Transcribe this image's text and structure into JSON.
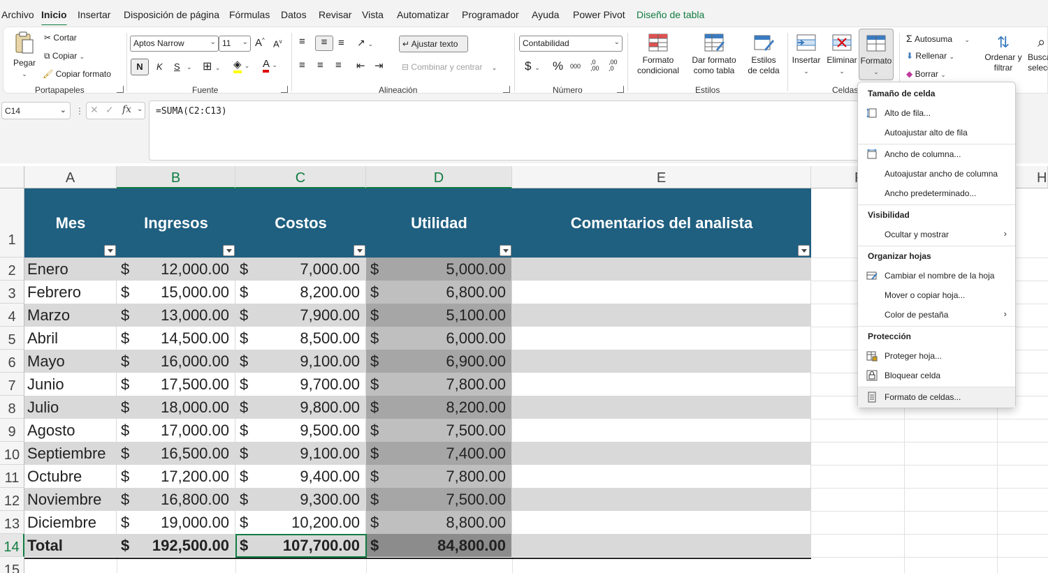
{
  "menu_tabs": [
    "Archivo",
    "Inicio",
    "Insertar",
    "Disposición de página",
    "Fórmulas",
    "Datos",
    "Revisar",
    "Vista",
    "Automatizar",
    "Programador",
    "Ayuda",
    "Power Pivot",
    "Diseño de tabla"
  ],
  "ribbon": {
    "clipboard": {
      "paste": "Pegar",
      "cut": "Cortar",
      "copy": "Copiar",
      "format_painter": "Copiar formato",
      "label": "Portapapeles"
    },
    "font": {
      "name": "Aptos Narrow",
      "size": "11",
      "bold": "N",
      "italic": "K",
      "underline": "S",
      "label": "Fuente"
    },
    "alignment": {
      "wrap": "Ajustar texto",
      "merge": "Combinar y centrar",
      "label": "Alineación"
    },
    "number": {
      "format": "Contabilidad",
      "currency": "$",
      "percent": "%",
      "thousands": "000",
      "inc_dec": ",0\n,00",
      "dec_dec": ",00\n,0",
      "label": "Número"
    },
    "styles": {
      "conditional": "Formato condicional",
      "as_table": "Dar formato como tabla",
      "cell_styles": "Estilos de celda",
      "label": "Estilos"
    },
    "cells": {
      "insert": "Insertar",
      "delete": "Eliminar",
      "format": "Formato",
      "label": "Celdas"
    },
    "editing": {
      "autosum": "Autosuma",
      "fill": "Rellenar",
      "clear": "Borrar",
      "sort": "Ordenar y filtrar",
      "find": "Buscar y seleccionar"
    }
  },
  "formula_bar": {
    "name_box": "C14",
    "formula": "=SUMA(C2:C13)",
    "fx": "fx"
  },
  "columns": [
    "A",
    "B",
    "C",
    "D",
    "E",
    "F",
    "H"
  ],
  "row_numbers": [
    "1",
    "2",
    "3",
    "4",
    "5",
    "6",
    "7",
    "8",
    "9",
    "10",
    "11",
    "12",
    "13",
    "14",
    "15"
  ],
  "table": {
    "headers": [
      "Mes",
      "Ingresos",
      "Costos",
      "Utilidad",
      "Comentarios del analista"
    ],
    "currency": "$",
    "rows": [
      [
        "Enero",
        "12,000.00",
        "7,000.00",
        "5,000.00"
      ],
      [
        "Febrero",
        "15,000.00",
        "8,200.00",
        "6,800.00"
      ],
      [
        "Marzo",
        "13,000.00",
        "7,900.00",
        "5,100.00"
      ],
      [
        "Abril",
        "14,500.00",
        "8,500.00",
        "6,000.00"
      ],
      [
        "Mayo",
        "16,000.00",
        "9,100.00",
        "6,900.00"
      ],
      [
        "Junio",
        "17,500.00",
        "9,700.00",
        "7,800.00"
      ],
      [
        "Julio",
        "18,000.00",
        "9,800.00",
        "8,200.00"
      ],
      [
        "Agosto",
        "17,000.00",
        "9,500.00",
        "7,500.00"
      ],
      [
        "Septiembre",
        "16,500.00",
        "9,100.00",
        "7,400.00"
      ],
      [
        "Octubre",
        "17,200.00",
        "9,400.00",
        "7,800.00"
      ],
      [
        "Noviembre",
        "16,800.00",
        "9,300.00",
        "7,500.00"
      ],
      [
        "Diciembre",
        "19,000.00",
        "10,200.00",
        "8,800.00"
      ]
    ],
    "total": [
      "Total",
      "192,500.00",
      "107,700.00",
      "84,800.00"
    ]
  },
  "format_menu": {
    "sec_size": "Tamaño de celda",
    "row_height": "Alto de fila...",
    "autofit_row": "Autoajustar alto de fila",
    "col_width": "Ancho de columna...",
    "autofit_col": "Autoajustar ancho de columna",
    "default_width": "Ancho predeterminado...",
    "sec_visibility": "Visibilidad",
    "hide_show": "Ocultar y mostrar",
    "sec_organize": "Organizar hojas",
    "rename": "Cambiar el nombre de la hoja",
    "move_copy": "Mover o copiar hoja...",
    "tab_color": "Color de pestaña",
    "sec_protection": "Protección",
    "protect": "Proteger hoja...",
    "lock": "Bloquear celda",
    "format_cells": "Formato de celdas..."
  },
  "colors": {
    "header_bg": "#1f5f80",
    "band_gray": "#d9d9d9",
    "util_light": "#bfbfbf",
    "util_dark": "#a6a6a6",
    "accent": "#107c41"
  }
}
